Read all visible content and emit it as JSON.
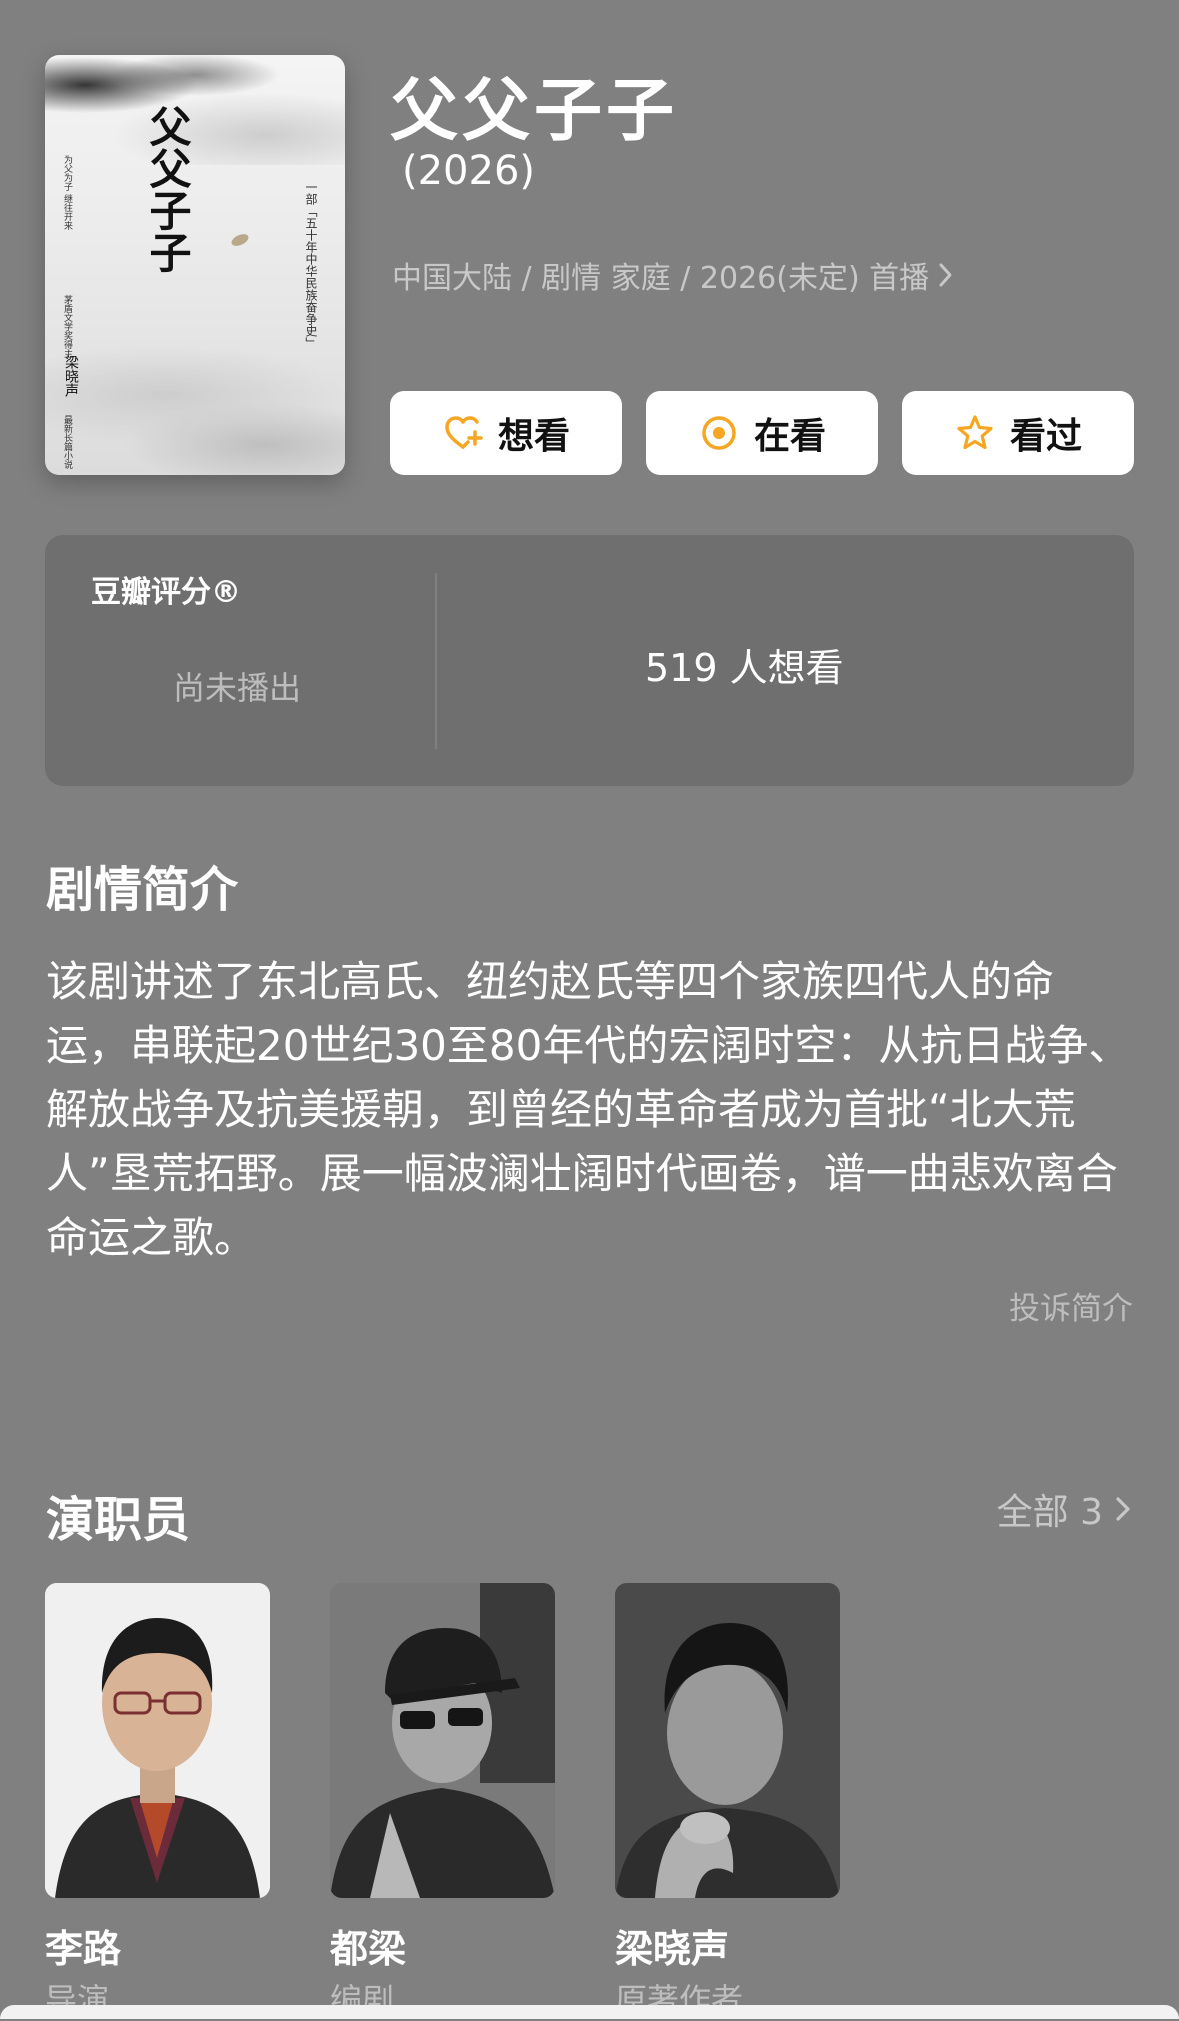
{
  "poster": {
    "title": "父父子子",
    "vertical_text_1": "一部「五十年中华民族奋争史」",
    "vertical_text_2": "为父为子 继往开来",
    "vertical_text_3": "茅盾文学奖得主",
    "author": "梁晓声",
    "publisher": "最新长篇小说"
  },
  "title": "父父子子",
  "year": "(2026)",
  "meta": "中国大陆 / 剧情 家庭 / 2026(未定) 首播",
  "actions": {
    "want": "想看",
    "watching": "在看",
    "watched": "看过"
  },
  "rating": {
    "label": "豆瓣评分®",
    "status": "尚未播出",
    "want_count": "519 人想看"
  },
  "synopsis": {
    "heading": "剧情简介",
    "text": "该剧讲述了东北高氏、纽约赵氏等四个家族四代人的命运，串联起20世纪30至80年代的宏阔时空：从抗日战争、解放战争及抗美援朝，到曾经的革命者成为首批“北大荒人”垦荒拓野。展一幅波澜壮阔时代画卷，谱一曲悲欢离合命运之歌。",
    "complaint": "投诉简介"
  },
  "cast": {
    "heading": "演职员",
    "all": "全部 3",
    "members": [
      {
        "name": "李路",
        "role": "导演"
      },
      {
        "name": "都梁",
        "role": "编剧"
      },
      {
        "name": "梁晓声",
        "role": "原著作者"
      }
    ]
  },
  "colors": {
    "background": "#808080",
    "accent_orange": "#F5A623",
    "card": "#6F6F6F"
  }
}
